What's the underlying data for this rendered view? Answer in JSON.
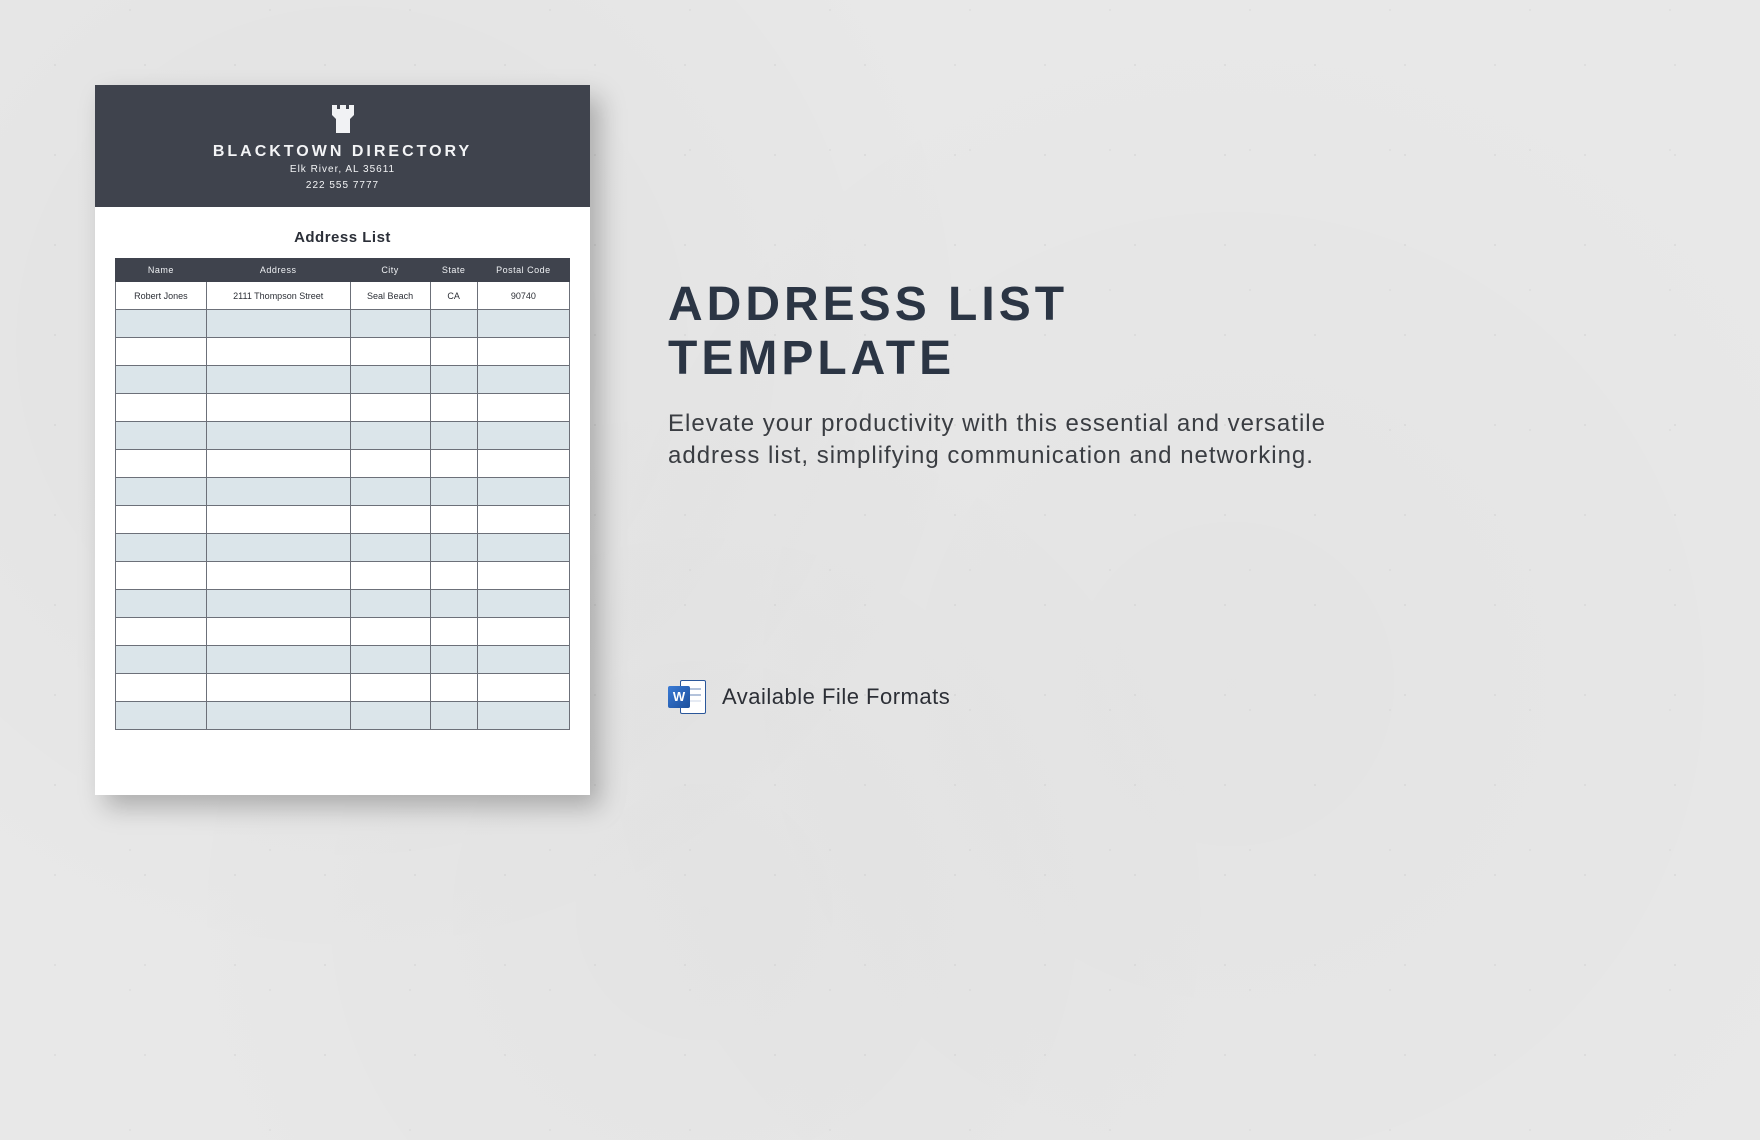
{
  "doc": {
    "org_name": "BLACKTOWN DIRECTORY",
    "address_line": "Elk River, AL 35611",
    "phone": "222 555 7777",
    "list_heading": "Address List",
    "columns": [
      "Name",
      "Address",
      "City",
      "State",
      "Postal Code"
    ],
    "rows": [
      {
        "name": "Robert Jones",
        "address": "2111 Thompson Street",
        "city": "Seal Beach",
        "state": "CA",
        "postal": "90740"
      }
    ],
    "blank_row_count": 15
  },
  "promo": {
    "title_line1": "ADDRESS LIST",
    "title_line2": "TEMPLATE",
    "description": "Elevate your productivity with this essential and versatile address list, simplifying communication and networking."
  },
  "formats": {
    "label": "Available File Formats",
    "word_badge": "W"
  },
  "colors": {
    "header_bg": "#3f434d",
    "row_alt_bg": "#dbe5ea",
    "title_color": "#2b3544"
  }
}
